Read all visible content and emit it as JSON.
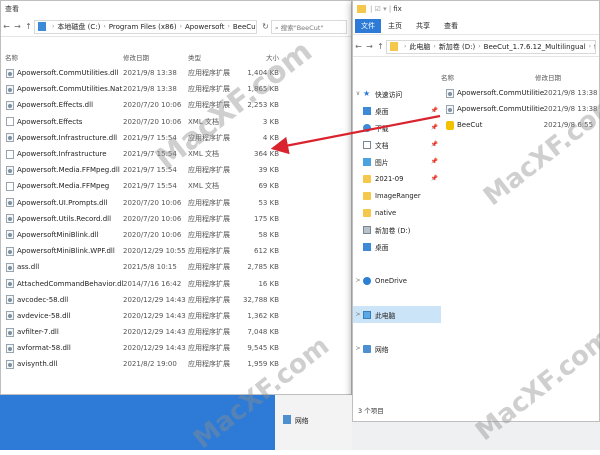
{
  "back_window": {
    "menu_label": "查看",
    "nav": {
      "back": "←",
      "forward": "→",
      "up": "↑"
    },
    "breadcrumb": [
      "本地磁盘 (C:)",
      "Program Files (x86)",
      "Apowersoft",
      "BeeCut"
    ],
    "search_placeholder": "搜索\"BeeCut\"",
    "columns": {
      "name": "名称",
      "date": "修改日期",
      "type": "类型",
      "size": "大小"
    },
    "files": [
      {
        "name": "Apowersoft.CommUtilities.dll",
        "date": "2021/9/8 13:38",
        "type": "应用程序扩展",
        "size": "1,404 KB",
        "icon": "gear"
      },
      {
        "name": "Apowersoft.CommUtilities.Native.dll",
        "date": "2021/9/8 13:38",
        "type": "应用程序扩展",
        "size": "1,865 KB",
        "icon": "gear"
      },
      {
        "name": "Apowersoft.Effects.dll",
        "date": "2020/7/20 10:06",
        "type": "应用程序扩展",
        "size": "2,253 KB",
        "icon": "gear"
      },
      {
        "name": "Apowersoft.Effects",
        "date": "2020/7/20 10:06",
        "type": "XML 文档",
        "size": "3 KB",
        "icon": "xml"
      },
      {
        "name": "Apowersoft.Infrastructure.dll",
        "date": "2021/9/7 15:54",
        "type": "应用程序扩展",
        "size": "4 KB",
        "icon": "gear"
      },
      {
        "name": "Apowersoft.Infrastructure",
        "date": "2021/9/7 15:54",
        "type": "XML 文档",
        "size": "364 KB",
        "icon": "xml"
      },
      {
        "name": "Apowersoft.Media.FFMpeg.dll",
        "date": "2021/9/7 15:54",
        "type": "应用程序扩展",
        "size": "39 KB",
        "icon": "gear"
      },
      {
        "name": "Apowersoft.Media.FFMpeg",
        "date": "2021/9/7 15:54",
        "type": "XML 文档",
        "size": "69 KB",
        "icon": "xml"
      },
      {
        "name": "Apowersoft.UI.Prompts.dll",
        "date": "2020/7/20 10:06",
        "type": "应用程序扩展",
        "size": "53 KB",
        "icon": "gear"
      },
      {
        "name": "Apowersoft.Utils.Record.dll",
        "date": "2020/7/20 10:06",
        "type": "应用程序扩展",
        "size": "175 KB",
        "icon": "gear"
      },
      {
        "name": "ApowersoftMiniBlink.dll",
        "date": "2020/7/20 10:06",
        "type": "应用程序扩展",
        "size": "58 KB",
        "icon": "gear"
      },
      {
        "name": "ApowersoftMiniBlink.WPF.dll",
        "date": "2020/12/29 10:55",
        "type": "应用程序扩展",
        "size": "612 KB",
        "icon": "gear"
      },
      {
        "name": "ass.dll",
        "date": "2021/5/8 10:15",
        "type": "应用程序扩展",
        "size": "2,785 KB",
        "icon": "gear"
      },
      {
        "name": "AttachedCommandBehavior.dll",
        "date": "2014/7/16 16:42",
        "type": "应用程序扩展",
        "size": "16 KB",
        "icon": "gear"
      },
      {
        "name": "avcodec-58.dll",
        "date": "2020/12/29 14:43",
        "type": "应用程序扩展",
        "size": "32,788 KB",
        "icon": "gear"
      },
      {
        "name": "avdevice-58.dll",
        "date": "2020/12/29 14:43",
        "type": "应用程序扩展",
        "size": "1,362 KB",
        "icon": "gear"
      },
      {
        "name": "avfilter-7.dll",
        "date": "2020/12/29 14:43",
        "type": "应用程序扩展",
        "size": "7,048 KB",
        "icon": "gear"
      },
      {
        "name": "avformat-58.dll",
        "date": "2020/12/29 14:43",
        "type": "应用程序扩展",
        "size": "9,545 KB",
        "icon": "gear"
      },
      {
        "name": "avisynth.dll",
        "date": "2021/8/2 19:00",
        "type": "应用程序扩展",
        "size": "1,959 KB",
        "icon": "gear"
      }
    ]
  },
  "front_window": {
    "title": "fix",
    "ribbon_tabs": [
      "文件",
      "主页",
      "共享",
      "查看"
    ],
    "nav": {
      "back": "←",
      "forward": "→",
      "up": "↑"
    },
    "breadcrumb": [
      "此电脑",
      "新加卷 (D:)",
      "BeeCut_1.7.6.12_Multilingual",
      "fix"
    ],
    "column_name": "名称",
    "column_date": "修改日期",
    "sidebar": [
      {
        "label": "快速访问",
        "icon": "star",
        "chevron": "∨",
        "pin": false,
        "selected": false
      },
      {
        "label": "桌面",
        "icon": "desktop",
        "chevron": "",
        "pin": true,
        "selected": false
      },
      {
        "label": "下载",
        "icon": "download",
        "chevron": "",
        "pin": true,
        "selected": false
      },
      {
        "label": "文档",
        "icon": "doc",
        "chevron": "",
        "pin": true,
        "selected": false
      },
      {
        "label": "图片",
        "icon": "pic",
        "chevron": "",
        "pin": true,
        "selected": false
      },
      {
        "label": "2021-09",
        "icon": "folder",
        "chevron": "",
        "pin": true,
        "selected": false
      },
      {
        "label": "ImageRanger",
        "icon": "folder",
        "chevron": "",
        "pin": false,
        "selected": false
      },
      {
        "label": "native",
        "icon": "folder",
        "chevron": "",
        "pin": false,
        "selected": false
      },
      {
        "label": "新加卷 (D:)",
        "icon": "drive",
        "chevron": "",
        "pin": false,
        "selected": false
      },
      {
        "label": "桌面",
        "icon": "desktop",
        "chevron": "",
        "pin": false,
        "selected": false
      },
      {
        "label": "",
        "icon": "",
        "chevron": "",
        "pin": false,
        "selected": false
      },
      {
        "label": "OneDrive",
        "icon": "cloud",
        "chevron": ">",
        "pin": false,
        "selected": false
      },
      {
        "label": "",
        "icon": "",
        "chevron": "",
        "pin": false,
        "selected": false
      },
      {
        "label": "此电脑",
        "icon": "pc",
        "chevron": ">",
        "pin": false,
        "selected": true
      },
      {
        "label": "",
        "icon": "",
        "chevron": "",
        "pin": false,
        "selected": false
      },
      {
        "label": "网络",
        "icon": "net",
        "chevron": ">",
        "pin": false,
        "selected": false
      }
    ],
    "files": [
      {
        "name": "Apowersoft.CommUtilities.dll",
        "date": "2021/9/8 13:38",
        "icon": "gear"
      },
      {
        "name": "Apowersoft.CommUtilities.Native.dll",
        "date": "2021/9/8 13:38",
        "icon": "gear"
      },
      {
        "name": "BeeCut",
        "date": "2021/9/8 6:55",
        "icon": "bee"
      }
    ],
    "status_text": "3 个项目"
  },
  "bottom_panel": {
    "network_label": "网络"
  },
  "watermarks": [
    "MacXF.com",
    "MacXF.com",
    "MacXF.com",
    "MacXF.com"
  ],
  "colors": {
    "accent": "#2d7bd6",
    "arrow": "#d9232e",
    "selection": "#cce4f7",
    "folder": "#f5c84c"
  }
}
